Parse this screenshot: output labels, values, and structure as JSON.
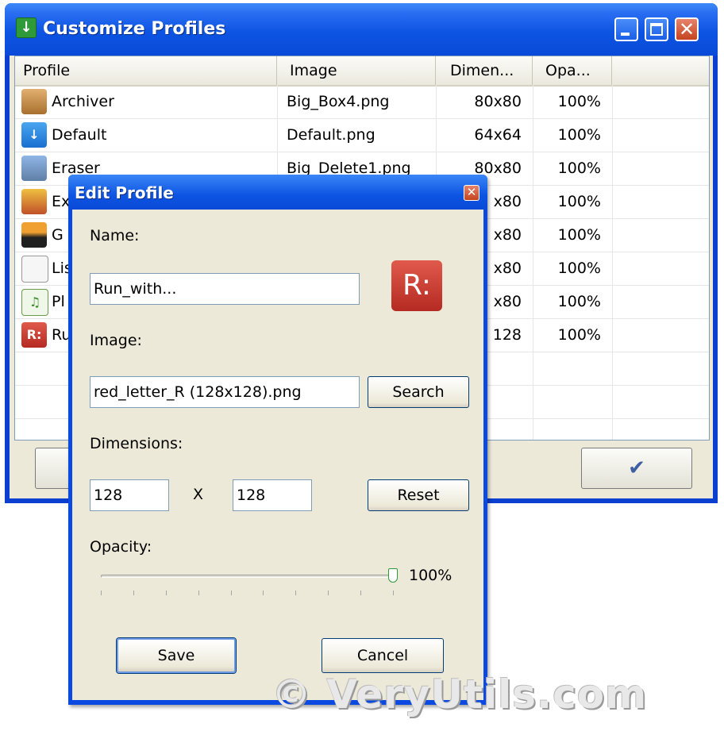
{
  "window": {
    "title": "Customize Profiles",
    "columns": [
      "Profile",
      "Image",
      "Dimen...",
      "Opa..."
    ],
    "rows": [
      {
        "profile": "Archiver",
        "image": "Big_Box4.png",
        "dimensions": "80x80",
        "opacity": "100%",
        "icon": "box-icon"
      },
      {
        "profile": "Default",
        "image": "Default.png",
        "dimensions": "64x64",
        "opacity": "100%",
        "icon": "down-arrow-icon"
      },
      {
        "profile": "Eraser",
        "image": "Big_Delete1.png",
        "dimensions": "80x80",
        "opacity": "100%",
        "icon": "shredder-icon"
      },
      {
        "profile": "Ex",
        "image": "",
        "dimensions": "x80",
        "opacity": "100%",
        "icon": "package-icon"
      },
      {
        "profile": "G",
        "image": "",
        "dimensions": "x80",
        "opacity": "100%",
        "icon": "picture-icon"
      },
      {
        "profile": "Lis",
        "image": "",
        "dimensions": "x80",
        "opacity": "100%",
        "icon": "document-icon"
      },
      {
        "profile": "Pl",
        "image": "",
        "dimensions": "x80",
        "opacity": "100%",
        "icon": "music-note-icon"
      },
      {
        "profile": "Ru",
        "image": "",
        "dimensions": "128",
        "opacity": "100%",
        "icon": "red-r-icon"
      }
    ],
    "ok_glyph": "✔"
  },
  "dialog": {
    "title": "Edit Profile",
    "name_label": "Name:",
    "name_value": "Run_with...",
    "image_label": "Image:",
    "image_value": "red_letter_R (128x128).png",
    "search_label": "Search",
    "dimensions_label": "Dimensions:",
    "width_value": "128",
    "times_glyph": "X",
    "height_value": "128",
    "reset_label": "Reset",
    "opacity_label": "Opacity:",
    "opacity_value": "100%",
    "opacity_level": 1.0,
    "save_label": "Save",
    "cancel_label": "Cancel",
    "logo_text": "R:"
  },
  "watermark": "© VeryUtils.com"
}
